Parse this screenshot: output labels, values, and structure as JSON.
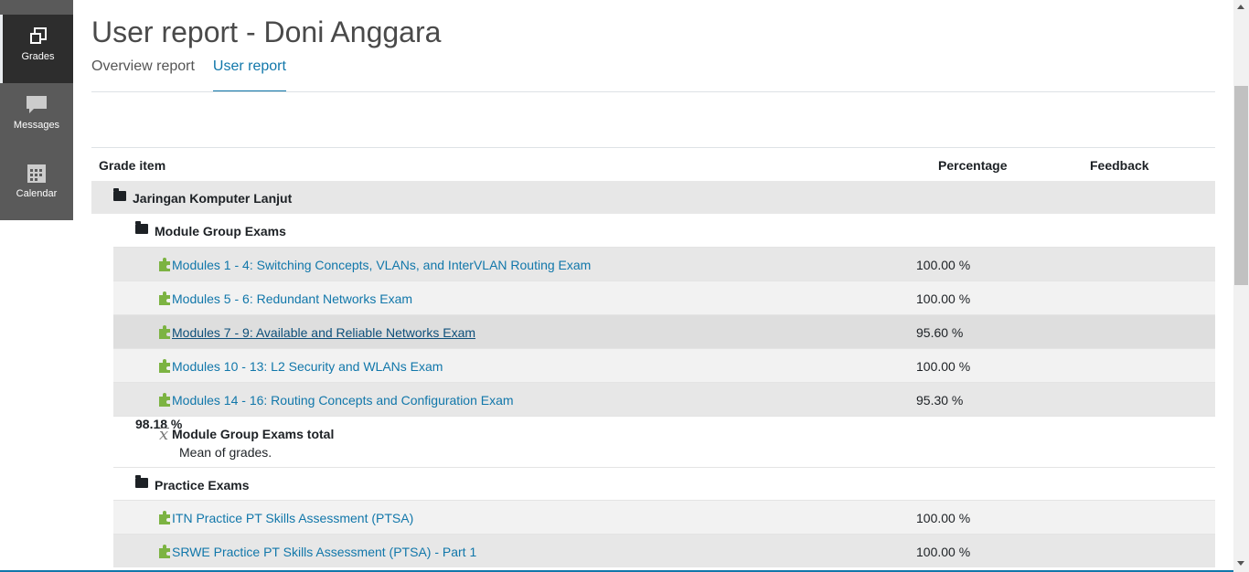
{
  "sidebar": {
    "items": [
      {
        "label": "Grades",
        "icon": "grades-icon",
        "active": true
      },
      {
        "label": "Messages",
        "icon": "messages-icon",
        "active": false
      },
      {
        "label": "Calendar",
        "icon": "calendar-icon",
        "active": false
      }
    ]
  },
  "page": {
    "title": "User report - Doni Anggara",
    "tabs": [
      {
        "label": "Overview report",
        "active": false
      },
      {
        "label": "User report",
        "active": true
      }
    ]
  },
  "table": {
    "headers": {
      "grade_item": "Grade item",
      "percentage": "Percentage",
      "feedback": "Feedback"
    },
    "course": "Jaringan Komputer Lanjut",
    "categories": [
      {
        "name": "Module Group Exams",
        "items": [
          {
            "name": "Modules 1 - 4: Switching Concepts, VLANs, and InterVLAN Routing Exam",
            "percentage": "100.00 %"
          },
          {
            "name": "Modules 5 - 6: Redundant Networks Exam",
            "percentage": "100.00 %"
          },
          {
            "name": "Modules 7 - 9: Available and Reliable Networks Exam",
            "percentage": "95.60 %"
          },
          {
            "name": "Modules 10 - 13: L2 Security and WLANs Exam",
            "percentage": "100.00 %"
          },
          {
            "name": "Modules 14 - 16: Routing Concepts and Configuration Exam",
            "percentage": "95.30 %"
          }
        ],
        "total": {
          "name": "Module Group Exams total",
          "note": "Mean of grades.",
          "percentage": "98.18 %"
        }
      },
      {
        "name": "Practice Exams",
        "items": [
          {
            "name": "ITN Practice PT Skills Assessment (PTSA)",
            "percentage": "100.00 %"
          },
          {
            "name": "SRWE Practice PT Skills Assessment (PTSA) - Part 1",
            "percentage": "100.00 %"
          }
        ]
      }
    ]
  },
  "colors": {
    "link": "#1177aa",
    "sidebar_bg": "#5a5a5a",
    "sidebar_active": "#2d2d2d",
    "puzzle": "#7cb342"
  }
}
